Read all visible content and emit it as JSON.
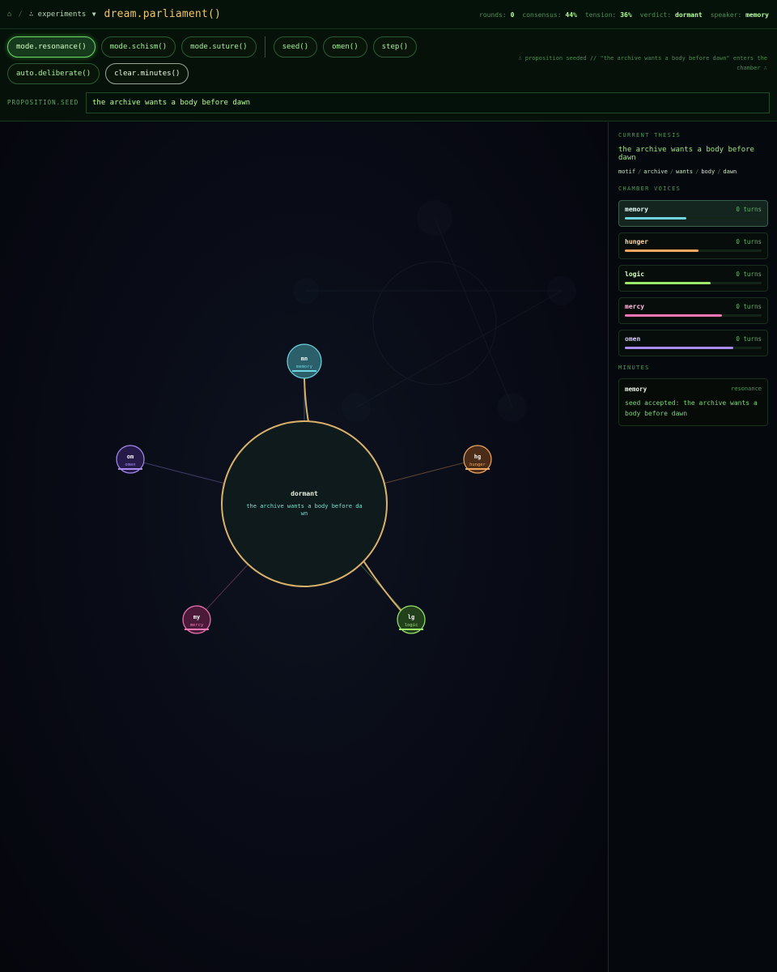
{
  "topbar": {
    "home": "⌂",
    "sep": "/",
    "experiments": "∴ experiments",
    "caret": "▼",
    "title": "dream.parliament()",
    "stats": [
      {
        "key": "rounds:",
        "value": "0"
      },
      {
        "key": "consensus:",
        "value": "44%"
      },
      {
        "key": "tension:",
        "value": "36%"
      },
      {
        "key": "verdict:",
        "value": "dormant"
      },
      {
        "key": "speaker:",
        "value": "memory"
      }
    ]
  },
  "controls": {
    "buttons": [
      {
        "label": "mode.resonance()",
        "name": "mode-resonance-button"
      },
      {
        "label": "mode.schism()",
        "name": "mode-schism-button"
      },
      {
        "label": "mode.suture()",
        "name": "mode-suture-button"
      },
      {
        "label": "seed()",
        "name": "seed-button"
      },
      {
        "label": "omen()",
        "name": "omen-button"
      },
      {
        "label": "step()",
        "name": "step-button"
      },
      {
        "label": "auto.deliberate()",
        "name": "auto-deliberate-button"
      },
      {
        "label": "clear.minutes()",
        "name": "clear-minutes-button"
      }
    ],
    "announcement": "∴ proposition seeded // \"the archive wants a body before dawn\" enters the chamber ∴",
    "seed_label": "PROPOSITION.SEED",
    "seed_value": "the archive wants a body before dawn"
  },
  "chamber": {
    "core_state": "dormant",
    "core_text_line1": "the archive wants a body before da",
    "core_text_line2": "wn",
    "voices": [
      {
        "abbr": "mn",
        "label": "memory",
        "color": "#6fd3e0",
        "fill": "#2b5f6a"
      },
      {
        "abbr": "hg",
        "label": "hunger",
        "color": "#f0a760",
        "fill": "#4a2c18"
      },
      {
        "abbr": "lg",
        "label": "logic",
        "color": "#9be86a",
        "fill": "#23401d"
      },
      {
        "abbr": "my",
        "label": "mercy",
        "color": "#ee77b6",
        "fill": "#4a1a38"
      },
      {
        "abbr": "om",
        "label": "omen",
        "color": "#a88cf0",
        "fill": "#251a48"
      }
    ]
  },
  "sidebar": {
    "thesis_header": "CURRENT THESIS",
    "thesis": "the archive wants a body before dawn",
    "motif_label": "motif",
    "motifs": [
      "archive",
      "wants",
      "body",
      "dawn"
    ],
    "voices_header": "CHAMBER VOICES",
    "voices": [
      {
        "name": "memory",
        "turns": "0 turns",
        "level": 0.45,
        "color": "#6fd3e0"
      },
      {
        "name": "hunger",
        "turns": "0 turns",
        "level": 0.54,
        "color": "#f0a760"
      },
      {
        "name": "logic",
        "turns": "0 turns",
        "level": 0.63,
        "color": "#9be86a"
      },
      {
        "name": "mercy",
        "turns": "0 turns",
        "level": 0.71,
        "color": "#ee77b6"
      },
      {
        "name": "omen",
        "turns": "0 turns",
        "level": 0.79,
        "color": "#a88cf0"
      }
    ],
    "minutes_header": "MINUTES",
    "minutes": [
      {
        "speaker": "memory",
        "mode": "resonance",
        "text": "seed accepted: the archive wants a body before dawn"
      }
    ]
  }
}
